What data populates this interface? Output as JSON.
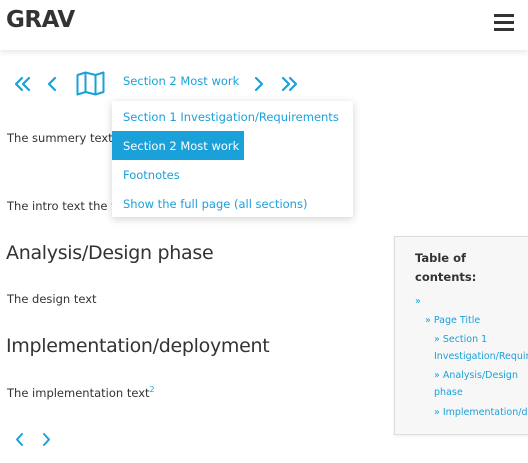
{
  "header": {
    "logo": "GRAV",
    "menu_icon": "hamburger-menu-icon"
  },
  "pager": {
    "icons": [
      "double-chevron-left-icon",
      "chevron-left-icon",
      "map-icon",
      "chevron-right-icon",
      "double-chevron-right-icon"
    ],
    "current_section": "Section 2 Most work"
  },
  "dropdown": {
    "items": [
      {
        "label": "Section 1 Investigation/Requirements",
        "active": false
      },
      {
        "label": "Section 2 Most work",
        "active": true
      },
      {
        "label": "Footnotes",
        "active": false
      },
      {
        "label": "Show the full page (all sections)",
        "active": false
      }
    ]
  },
  "content": {
    "summary_text": "The summery text",
    "intro_text": "The intro text the w",
    "analysis_heading": "Analysis/Design phase",
    "design_text": "The design text",
    "implementation_heading": "Implementation/deployment",
    "implementation_text": "The implementation text",
    "footnote_ref": "2"
  },
  "toc": {
    "title": "Table of contents:",
    "links": [
      {
        "label": "»"
      },
      {
        "label": "» Page Title"
      },
      {
        "label": "» Section 1"
      },
      {
        "label": "Investigation/Requirements"
      },
      {
        "label": "» Analysis/Design"
      },
      {
        "label": "phase"
      },
      {
        "label": "» Implementation/deployment"
      }
    ]
  },
  "bottom_nav": {
    "icons": [
      "chevron-left-icon",
      "chevron-right-icon"
    ]
  },
  "colors": {
    "accent": "#1ba1d9",
    "text": "#333333",
    "toc_background": "#f7f7f7"
  }
}
